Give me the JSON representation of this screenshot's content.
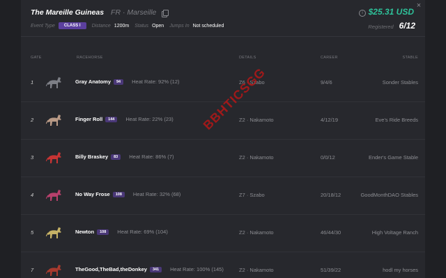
{
  "header": {
    "title": "The Mareille Guineas",
    "location": "FR · Marseille",
    "price": "$25.31 USD",
    "close_symbol": "×",
    "info_symbol": "i",
    "registered_label": "Registered",
    "registered_value": "6/12"
  },
  "meta": {
    "event_type_label": "Event Type",
    "event_type_value": "CLASS I",
    "distance_label": "Distance",
    "distance_value": "1200m",
    "status_label": "Status",
    "status_value": "Open",
    "jumps_label": "Jumps In",
    "jumps_value": "Not scheduled"
  },
  "columns": {
    "gate": "GATE",
    "racehorse": "RACEHORSE",
    "details": "DETAILS",
    "career": "CAREER",
    "stable": "STABLE"
  },
  "watermark": "BBHTICSGG",
  "rows": [
    {
      "gate": "1",
      "name": "Gray Anatomy",
      "rating": "94",
      "heat": "Heat Rate: 92% (12)",
      "details": "Z6 · Szabo",
      "career": "9/4/6",
      "stable": "Sonder Stables",
      "horse_color": "#7d7f86"
    },
    {
      "gate": "2",
      "name": "Finger Roll",
      "rating": "144",
      "heat": "Heat Rate: 22% (23)",
      "details": "Z2 · Nakamoto",
      "career": "4/12/19",
      "stable": "Eve's Ride Breeds",
      "horse_color": "#b99a86"
    },
    {
      "gate": "3",
      "name": "Billy Braskey",
      "rating": "83",
      "heat": "Heat Rate: 86% (7)",
      "details": "Z2 · Nakamoto",
      "career": "0/0/12",
      "stable": "Ender's Game Stable",
      "horse_color": "#c63434"
    },
    {
      "gate": "4",
      "name": "No Way Frose",
      "rating": "108",
      "heat": "Heat Rate: 32% (68)",
      "details": "Z7 · Szabo",
      "career": "20/18/12",
      "stable": "GoodMonthDAO Stables",
      "horse_color": "#b8406c"
    },
    {
      "gate": "5",
      "name": "Newton",
      "rating": "108",
      "heat": "Heat Rate: 69% (104)",
      "details": "Z2 · Nakamoto",
      "career": "46/44/30",
      "stable": "High Voltage Ranch",
      "horse_color": "#c6b266"
    },
    {
      "gate": "7",
      "name": "TheGood,TheBad,theDonkey",
      "rating": "341",
      "heat": "Heat Rate: 100% (145)",
      "details": "Z2 · Nakamoto",
      "career": "51/39/22",
      "stable": "hodl my horses",
      "horse_color": "#a83a2e"
    }
  ]
}
